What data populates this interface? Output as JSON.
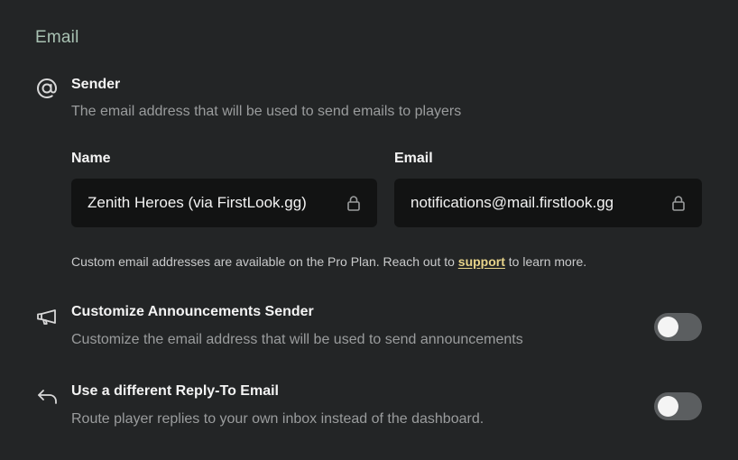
{
  "section": {
    "title": "Email"
  },
  "sender": {
    "icon": "at-sign-icon",
    "title": "Sender",
    "description": "The email address that will be used to send emails to players",
    "name_label": "Name",
    "name_value": "Zenith Heroes (via FirstLook.gg)",
    "email_label": "Email",
    "email_value": "notifications@mail.firstlook.gg",
    "lock_icon": "lock-icon"
  },
  "note": {
    "text_before": "Custom email addresses are available on the Pro Plan. Reach out to ",
    "link_label": "support",
    "text_after": " to learn more."
  },
  "announcements": {
    "icon": "megaphone-icon",
    "title": "Customize Announcements Sender",
    "description": "Customize the email address that will be used to send announcements",
    "enabled": false
  },
  "reply_to": {
    "icon": "reply-arrow-icon",
    "title": "Use a different Reply-To Email",
    "description": "Route player replies to your own inbox instead of the dashboard.",
    "enabled": false
  },
  "colors": {
    "background": "#232526",
    "section_title": "#a9c2b3",
    "field_bg": "#121313",
    "link": "#e8d48a",
    "toggle_off": "#5b5e60"
  }
}
